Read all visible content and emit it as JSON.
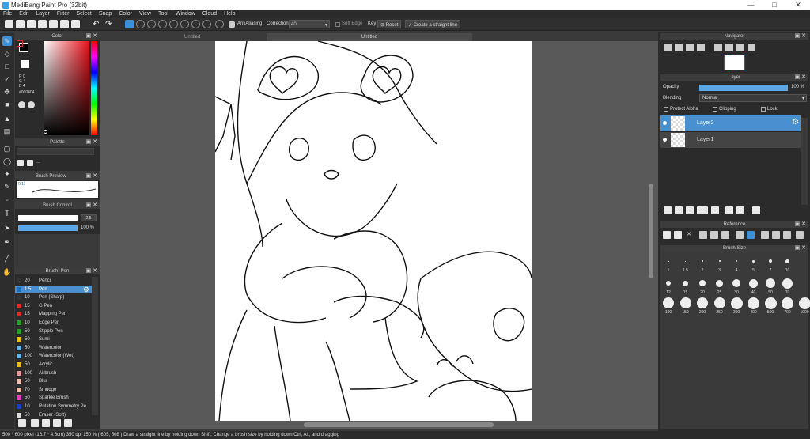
{
  "title": "MediBang Paint Pro (32bit)",
  "menu": [
    "File",
    "Edit",
    "Layer",
    "Filter",
    "Select",
    "Snap",
    "Color",
    "View",
    "Tool",
    "Window",
    "Cloud",
    "Help"
  ],
  "toolbar": {
    "antialiasing": "AntiAliasing",
    "correction_label": "Correction",
    "correction_value": "40",
    "soft_edge": "Soft Edge",
    "key_label": "Key",
    "reset": "Reset",
    "straight_line": "Create a straight line"
  },
  "tabs": {
    "left": "Untitled",
    "center": "Untitled"
  },
  "color_panel": {
    "title": "Color",
    "r": "R 0",
    "g": "G 4",
    "b": "B 4",
    "hex": "#000404"
  },
  "palette_panel": {
    "title": "Palette"
  },
  "brush_preview": {
    "title": "Brush Preview",
    "size": "0.11"
  },
  "brush_control": {
    "title": "Brush Control",
    "size_value": "2.5",
    "opacity_value": "100 %"
  },
  "brush_panel": {
    "title": "Brush: Pen",
    "items": [
      {
        "size": "20",
        "name": "Pencil",
        "color": "#333333"
      },
      {
        "size": "1.5",
        "name": "Pen",
        "color": "#1a6fb8"
      },
      {
        "size": "10",
        "name": "Pen (Sharp)",
        "color": "#333333"
      },
      {
        "size": "15",
        "name": "G Pen",
        "color": "#d83030"
      },
      {
        "size": "15",
        "name": "Mapping Pen",
        "color": "#d83030"
      },
      {
        "size": "10",
        "name": "Edge Pen",
        "color": "#2aa02a"
      },
      {
        "size": "50",
        "name": "Stipple Pen",
        "color": "#2aa02a"
      },
      {
        "size": "50",
        "name": "Sumi",
        "color": "#e6c020"
      },
      {
        "size": "50",
        "name": "Watercolor",
        "color": "#6ab8e8"
      },
      {
        "size": "100",
        "name": "Watercolor (Wet)",
        "color": "#6ab8e8"
      },
      {
        "size": "50",
        "name": "Acrylic",
        "color": "#e6c020"
      },
      {
        "size": "100",
        "name": "Airbrush",
        "color": "#e89aa0"
      },
      {
        "size": "50",
        "name": "Blur",
        "color": "#f0c0b0"
      },
      {
        "size": "70",
        "name": "Smudge",
        "color": "#f0c0b0"
      },
      {
        "size": "50",
        "name": "Sparkle Brush",
        "color": "#e040c0"
      },
      {
        "size": "10",
        "name": "Rotation Symmetry Pe",
        "color": "#1a40c0"
      },
      {
        "size": "50",
        "name": "Eraser (Soft)",
        "color": "#dddddd"
      }
    ]
  },
  "navigator": {
    "title": "Navigator"
  },
  "layer_panel": {
    "title": "Layer",
    "opacity_label": "Opacity",
    "opacity_value": "100 %",
    "opacity_fraction": 1.0,
    "blending_label": "Blending",
    "blending_value": "Normal",
    "protect_alpha": "Protect Alpha",
    "clipping": "Clipping",
    "lock": "Lock",
    "layers": [
      "Layer2",
      "Layer1"
    ]
  },
  "reference": {
    "title": "Reference"
  },
  "brush_size": {
    "title": "Brush Size",
    "sizes": [
      "1",
      "1.5",
      "2",
      "3",
      "4",
      "5",
      "7",
      "10",
      "12",
      "15",
      "20",
      "25",
      "30",
      "40",
      "50",
      "70",
      "100",
      "150",
      "200",
      "250",
      "300",
      "400",
      "500",
      "700",
      "1000"
    ]
  },
  "status": "500 * 600 pixel  (16.7 * 4.6cm)  350 dpi  150 %  ( 605, 508 )  Draw a straight line by holding down Shift, Change a brush size by holding down Ctrl, Alt, and dragging"
}
